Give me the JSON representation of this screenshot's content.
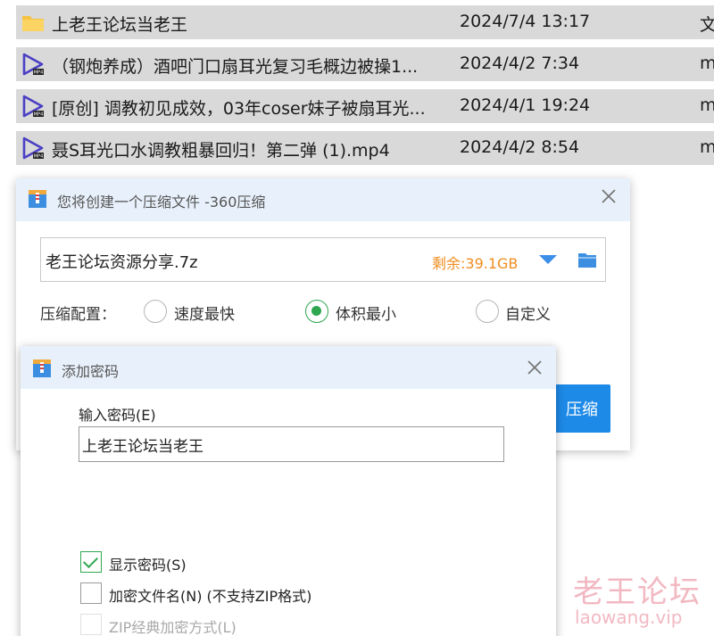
{
  "file_list": [
    {
      "icon": "folder-icon",
      "name": "上老王论坛当老王",
      "date": "2024/7/4 13:17",
      "type": "文"
    },
    {
      "icon": "video-file-icon",
      "name": "（钢炮养成）酒吧门口扇耳光复习毛概边被操1...",
      "date": "2024/4/2 7:34",
      "type": "m"
    },
    {
      "icon": "video-file-icon",
      "name": "[原创] 调教初见成效，03年coser妹子被扇耳光...",
      "date": "2024/4/1 19:24",
      "type": "m"
    },
    {
      "icon": "video-file-icon",
      "name": "聂S耳光口水调教粗暴回归！第二弹 (1).mp4",
      "date": "2024/4/2 8:54",
      "type": "m"
    }
  ],
  "compress_dialog": {
    "title": "您将创建一个压缩文件 -360压缩",
    "archive_name": "老王论坛资源分享.7z",
    "free_space": "剩余:39.1GB",
    "config_label": "压缩配置：",
    "options": [
      {
        "label": "速度最快",
        "checked": false
      },
      {
        "label": "体积最小",
        "checked": true
      },
      {
        "label": "自定义",
        "checked": false
      }
    ],
    "compress_button": "压缩"
  },
  "password_dialog": {
    "title": "添加密码",
    "input_label": "输入密码(E)",
    "password_value": "上老王论坛当老王",
    "checkboxes": [
      {
        "label": "显示密码(S)",
        "checked": true,
        "disabled": false
      },
      {
        "label": "加密文件名(N) (不支持ZIP格式)",
        "checked": false,
        "disabled": false
      },
      {
        "label": "ZIP经典加密方式(L)",
        "checked": false,
        "disabled": true
      }
    ]
  },
  "watermark": {
    "title": "老王论坛",
    "url": "laowang.vip"
  },
  "colors": {
    "accent": "#1e8ae8",
    "radio_checked": "#2fa750",
    "free_space": "#f08c1e",
    "title_bar": "#e8f1fb",
    "file_row": "#d9d9d9"
  }
}
